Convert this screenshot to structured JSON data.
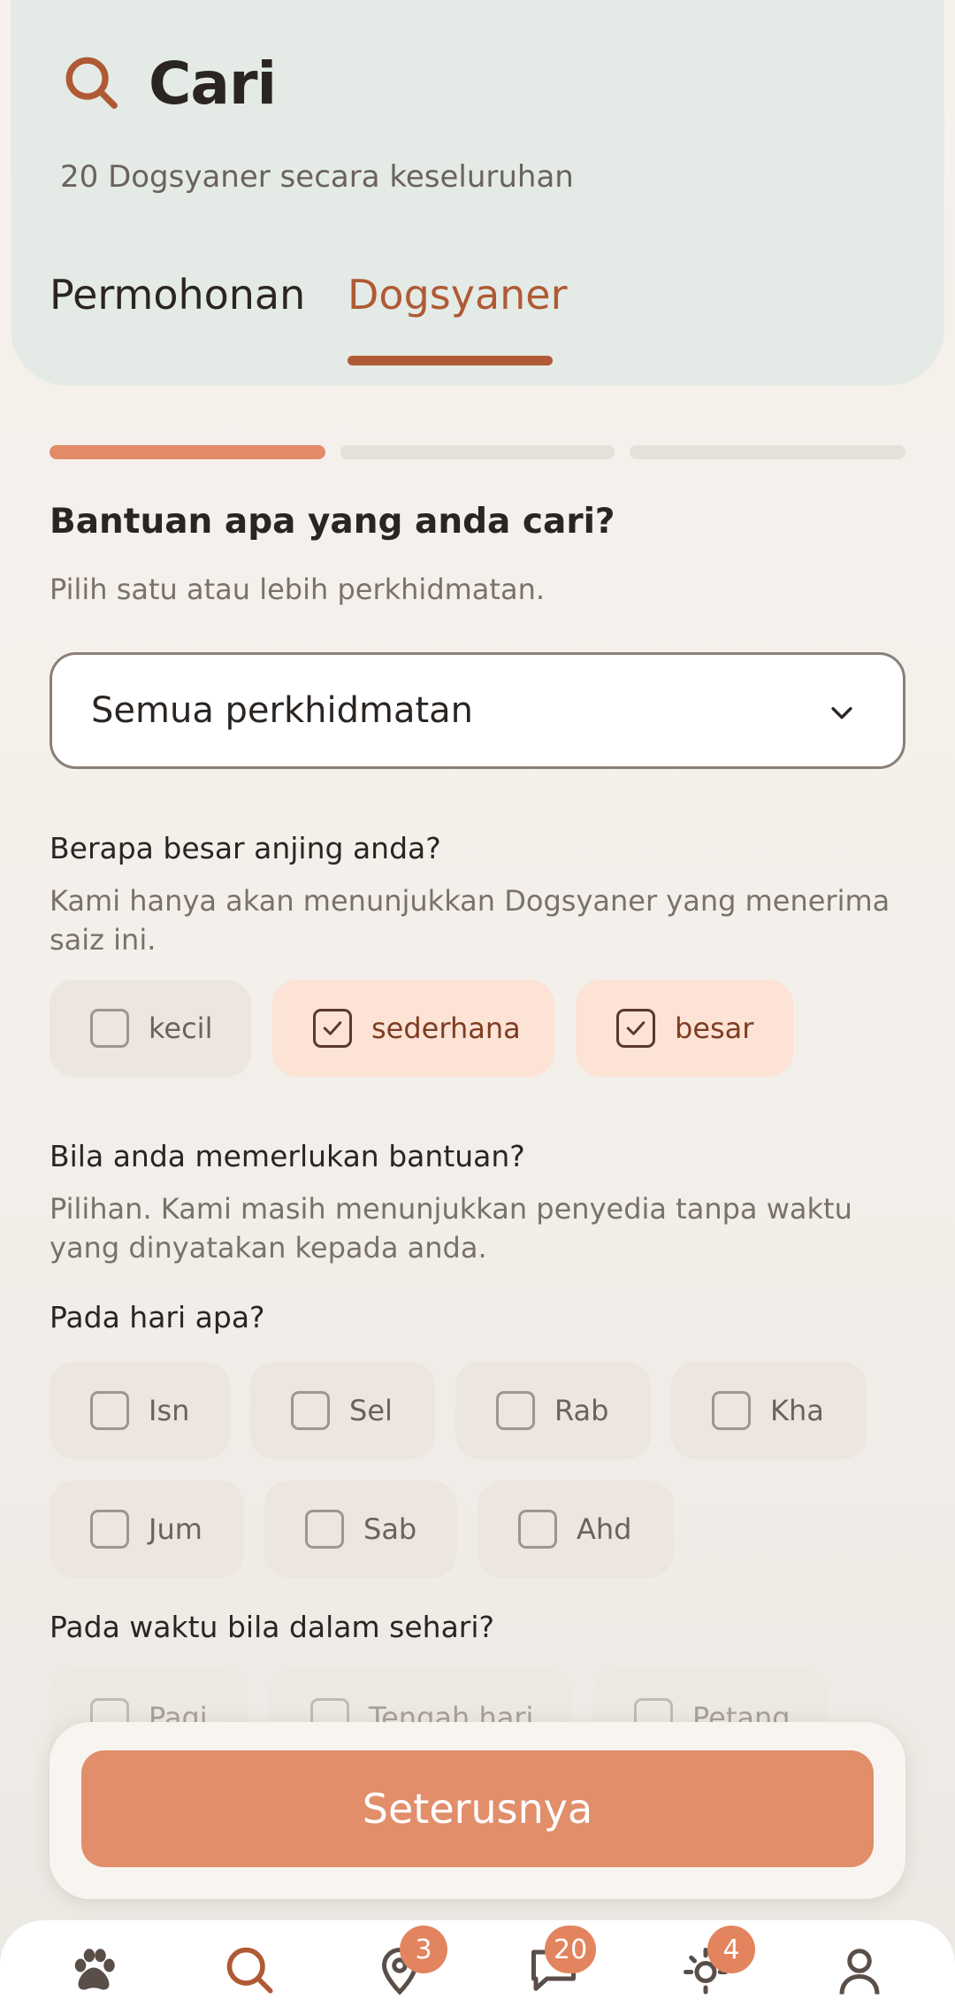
{
  "header": {
    "title": "Cari",
    "subtitle": "20 Dogsyaner secara keseluruhan",
    "tabs": [
      {
        "label": "Permohonan",
        "active": false
      },
      {
        "label": "Dogsyaner",
        "active": true
      }
    ]
  },
  "wizard": {
    "step": 1,
    "total_steps": 3
  },
  "services": {
    "question": "Bantuan apa yang anda cari?",
    "hint": "Pilih satu atau lebih perkhidmatan.",
    "selected": "Semua perkhidmatan"
  },
  "dog_size": {
    "question": "Berapa besar anjing anda?",
    "hint": "Kami hanya akan menunjukkan Dogsyaner yang menerima saiz ini.",
    "options": [
      {
        "label": "kecil",
        "checked": false
      },
      {
        "label": "sederhana",
        "checked": true
      },
      {
        "label": "besar",
        "checked": true
      }
    ]
  },
  "when": {
    "question": "Bila anda memerlukan bantuan?",
    "hint": "Pilihan. Kami masih menunjukkan penyedia tanpa waktu yang dinyatakan kepada anda.",
    "days_question": "Pada hari apa?",
    "days": [
      {
        "label": "Isn",
        "checked": false
      },
      {
        "label": "Sel",
        "checked": false
      },
      {
        "label": "Rab",
        "checked": false
      },
      {
        "label": "Kha",
        "checked": false
      },
      {
        "label": "Jum",
        "checked": false
      },
      {
        "label": "Sab",
        "checked": false
      },
      {
        "label": "Ahd",
        "checked": false
      }
    ],
    "time_question": "Pada waktu bila dalam sehari?",
    "times": [
      {
        "label": "Pagi",
        "checked": false
      },
      {
        "label": "Tengah hari",
        "checked": false
      },
      {
        "label": "Petang",
        "checked": false
      }
    ]
  },
  "cta": {
    "label": "Seterusnya"
  },
  "nav": {
    "items": [
      {
        "icon": "paw-icon"
      },
      {
        "icon": "search-icon",
        "active": true
      },
      {
        "icon": "map-pin-icon",
        "badge": "3"
      },
      {
        "icon": "chat-icon",
        "badge": "20"
      },
      {
        "icon": "sun-icon",
        "badge": "4"
      },
      {
        "icon": "profile-icon"
      }
    ]
  },
  "colors": {
    "accent": "#b05a35",
    "cta": "#e28e6b",
    "header_bg": "#e4ebe6",
    "chip_selected": "#fde2d6"
  }
}
